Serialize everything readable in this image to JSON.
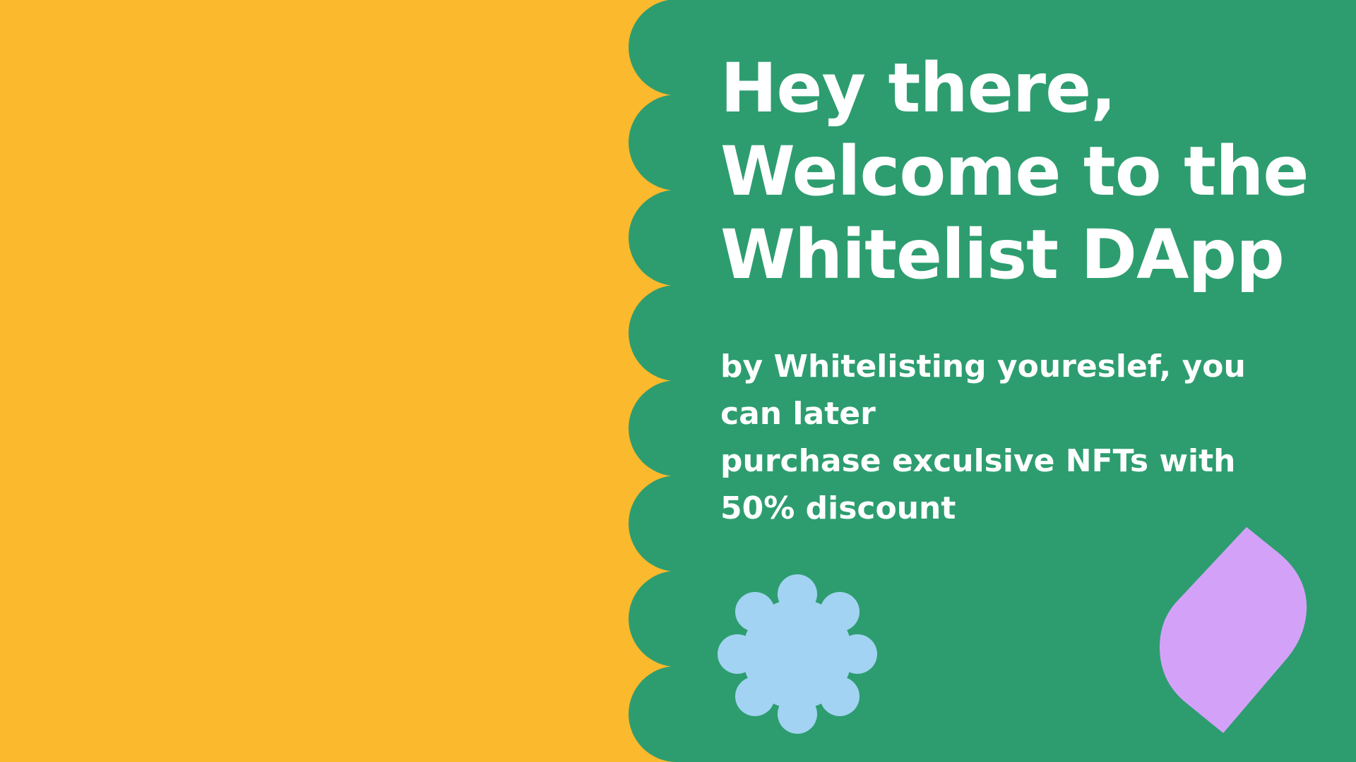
{
  "colors": {
    "background": "#fbb92d",
    "panel": "#2d9d6f",
    "text": "#ffffff",
    "flower": "#a2d3f2",
    "leaf": "#d3a2f8"
  },
  "hero": {
    "title_lines": [
      "Hey there,",
      "Welcome to the",
      "Whitelist DApp"
    ],
    "subtitle_lines": [
      "by Whitelisting youreslef, you",
      "can later",
      "purchase exculsive NFTs with",
      "50% discount"
    ]
  },
  "decorations": {
    "flower_icon": "flower-icon",
    "leaf_icon": "leaf-icon"
  }
}
